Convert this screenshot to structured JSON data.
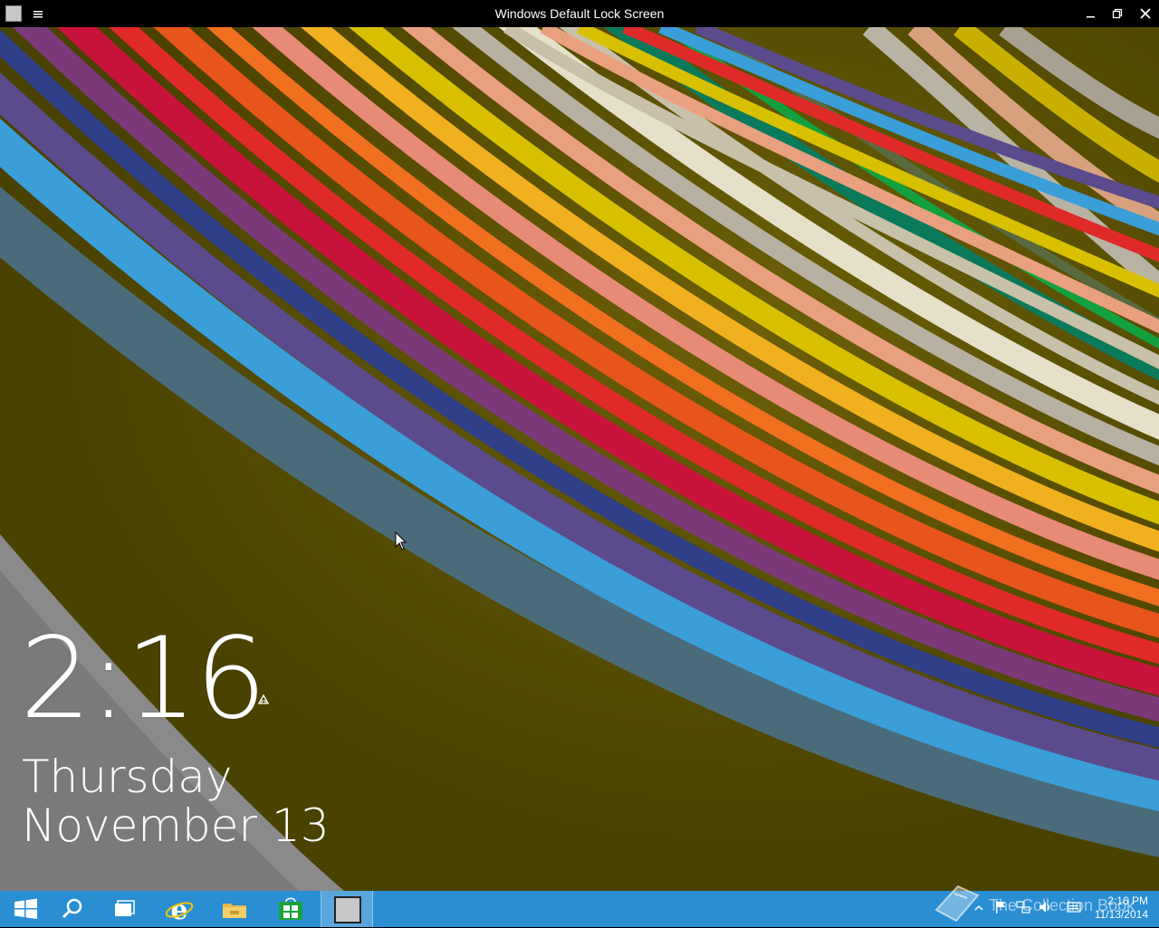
{
  "window": {
    "title": "Windows Default Lock Screen"
  },
  "lockscreen": {
    "time": "2:16",
    "day": "Thursday",
    "date": "November 13"
  },
  "taskbar": {
    "clock_time": "2:16 PM",
    "clock_date": "11/13/2014",
    "accent_color": "#2a8ed3",
    "icons": [
      "start-icon",
      "search-icon",
      "task-view-icon",
      "internet-explorer-icon",
      "file-explorer-icon",
      "store-icon",
      "lock-screen-app-icon"
    ]
  },
  "watermark": {
    "text": "The Collection Book"
  }
}
